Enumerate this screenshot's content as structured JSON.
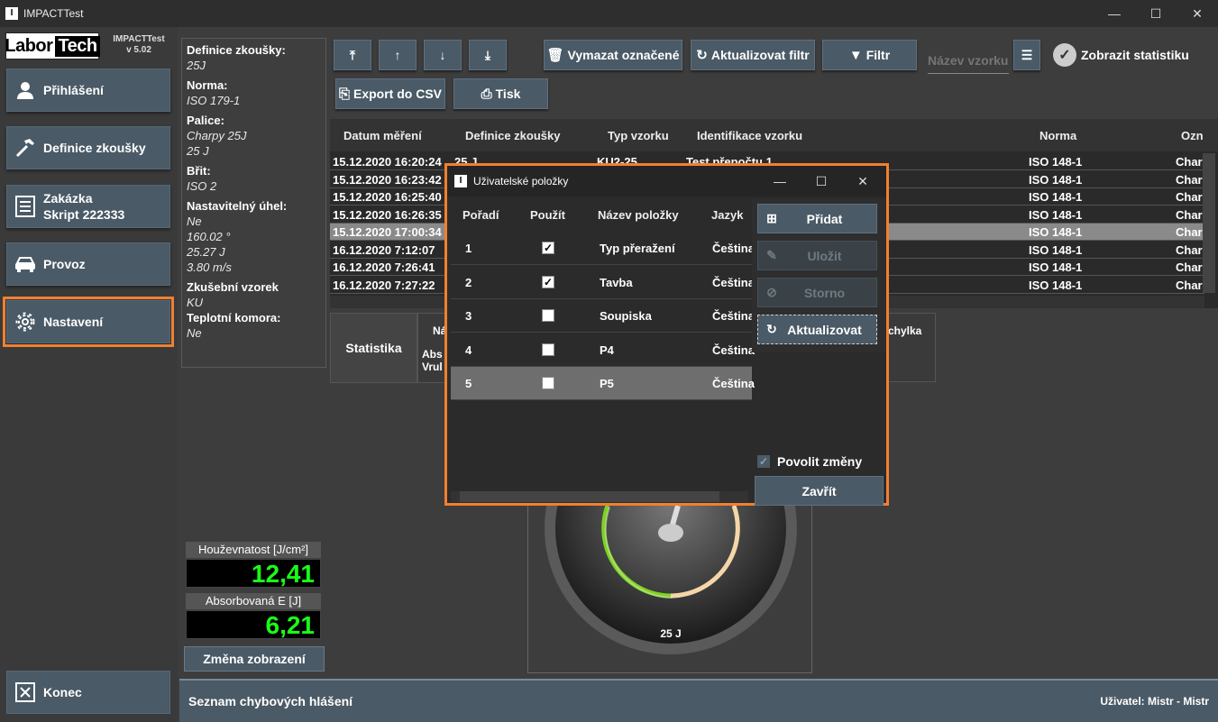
{
  "window": {
    "title": "IMPACTTest",
    "logo_glyph": "I",
    "minimize": "—",
    "maximize": "☐",
    "close": "✕"
  },
  "brand": {
    "logo_left": "Labor",
    "logo_right": "Tech",
    "app_name": "IMPACTTest",
    "version": "v 5.02"
  },
  "nav": {
    "login": "Přihlášení",
    "test_def": "Definice zkoušky",
    "order_line1": "Zakázka",
    "order_line2": "Skript 222333",
    "operation": "Provoz",
    "settings": "Nastavení",
    "exit": "Konec"
  },
  "info": [
    {
      "key": "Definice zkoušky:",
      "values": [
        "25J"
      ]
    },
    {
      "key": "Norma:",
      "values": [
        "ISO 179-1"
      ]
    },
    {
      "key": "Palice:",
      "values": [
        "Charpy 25J",
        "25 J"
      ]
    },
    {
      "key": "Břit:",
      "values": [
        "ISO 2"
      ]
    },
    {
      "key": "Nastavitelný úhel:",
      "values": [
        "Ne",
        "160.02 °",
        "25.27 J",
        "3.80 m/s"
      ]
    },
    {
      "key": "Zkušební vzorek",
      "values": [
        "KU"
      ]
    },
    {
      "key": "Teplotní komora:",
      "values": [
        "Ne"
      ]
    }
  ],
  "meters": {
    "toughness_label": "Houževnatost [J/cm²]",
    "toughness_value": "12,41",
    "absorbed_label": "Absorbovaná E [J]",
    "absorbed_value": "6,21",
    "change_view": "Změna zobrazení"
  },
  "toolbar": {
    "delete_marked": "Vymazat označené",
    "refresh_filter": "Aktualizovat filtr",
    "filter": "Filtr",
    "sample_name_placeholder": "Název vzorku",
    "show_stats": "Zobrazit statistiku",
    "export_csv": "Export do CSV",
    "print": "Tisk"
  },
  "table": {
    "columns": [
      "Datum měření",
      "Definice zkoušky",
      "Typ vzorku",
      "Identifikace vzorku",
      "Norma",
      "Ozn"
    ],
    "rows": [
      {
        "date": "15.12.2020 16:20:24",
        "def": "25 J",
        "type": "KU2-25",
        "ident": "Test přepočtu 1",
        "norm": "ISO 148-1",
        "oz": "Charp"
      },
      {
        "date": "15.12.2020 16:23:42",
        "def": "",
        "type": "",
        "ident": "",
        "norm": "ISO 148-1",
        "oz": "Charp"
      },
      {
        "date": "15.12.2020 16:25:40",
        "def": "",
        "type": "",
        "ident": "",
        "norm": "ISO 148-1",
        "oz": "Charp"
      },
      {
        "date": "15.12.2020 16:26:35",
        "def": "",
        "type": "",
        "ident": "",
        "norm": "ISO 148-1",
        "oz": "Charp"
      },
      {
        "date": "15.12.2020 17:00:34",
        "def": "",
        "type": "",
        "ident": "",
        "norm": "ISO 148-1",
        "oz": "Charp"
      },
      {
        "date": "16.12.2020 7:12:07",
        "def": "",
        "type": "",
        "ident": "",
        "norm": "ISO 148-1",
        "oz": "Charp"
      },
      {
        "date": "16.12.2020 7:26:41",
        "def": "",
        "type": "",
        "ident": "",
        "norm": "ISO 148-1",
        "oz": "Charp"
      },
      {
        "date": "16.12.2020 7:27:22",
        "def": "",
        "type": "",
        "ident": "",
        "norm": "ISO 148-1",
        "oz": "Charp"
      }
    ],
    "selected_row": 4
  },
  "stats": {
    "label": "Statistika",
    "col_partial": "Ná",
    "row1": "Abs",
    "row2": "Vrul",
    "col_right": "chylka"
  },
  "gauge": {
    "label": "25 J"
  },
  "dialog": {
    "title": "Uživatelské položky",
    "columns": [
      "Pořadí",
      "Použít",
      "Název položky",
      "Jazyk"
    ],
    "rows": [
      {
        "order": "1",
        "use": true,
        "name": "Typ přeražení",
        "lang": "Čeština"
      },
      {
        "order": "2",
        "use": true,
        "name": "Tavba",
        "lang": "Čeština"
      },
      {
        "order": "3",
        "use": false,
        "name": "Soupiska",
        "lang": "Čeština"
      },
      {
        "order": "4",
        "use": false,
        "name": "P4",
        "lang": "Čeština"
      },
      {
        "order": "5",
        "use": false,
        "name": "P5",
        "lang": "Čeština"
      }
    ],
    "add": "Přidat",
    "save": "Uložit",
    "cancel": "Storno",
    "refresh": "Aktualizovat",
    "allow_changes": "Povolit změny",
    "close": "Zavřít"
  },
  "status": {
    "errors": "Seznam chybových hlášení",
    "user": "Uživatel: Mistr  -  Mistr"
  },
  "colors": {
    "accent_orange": "#f08030",
    "button": "#4a5a66",
    "meter_green": "#19ff19"
  }
}
